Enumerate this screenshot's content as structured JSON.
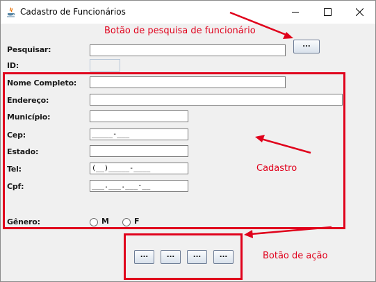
{
  "window": {
    "title": "Cadastro de Funcionários"
  },
  "search": {
    "label": "Pesquisar:",
    "value": "",
    "button_label": "..."
  },
  "id_label": "ID:",
  "form": {
    "nome_label": "Nome Completo:",
    "endereco_label": "Endereço:",
    "municipio_label": "Município:",
    "cep_label": "Cep:",
    "cep_mask": "_____-___",
    "estado_label": "Estado:",
    "tel_label": "Tel:",
    "tel_mask": "(__)_____-____",
    "cpf_label": "Cpf:",
    "cpf_mask": "___.___.___-__",
    "genero_label": "Gênero:",
    "genero_options": [
      "M",
      "F"
    ]
  },
  "actions": [
    "...",
    "...",
    "...",
    "..."
  ],
  "annotations": {
    "search_button": "Botão de pesquisa de funcionário",
    "form": "Cadastro",
    "actions": "Botão de ação"
  },
  "colors": {
    "annotation": "#e0001b",
    "window_bg": "#f0f0f0"
  }
}
